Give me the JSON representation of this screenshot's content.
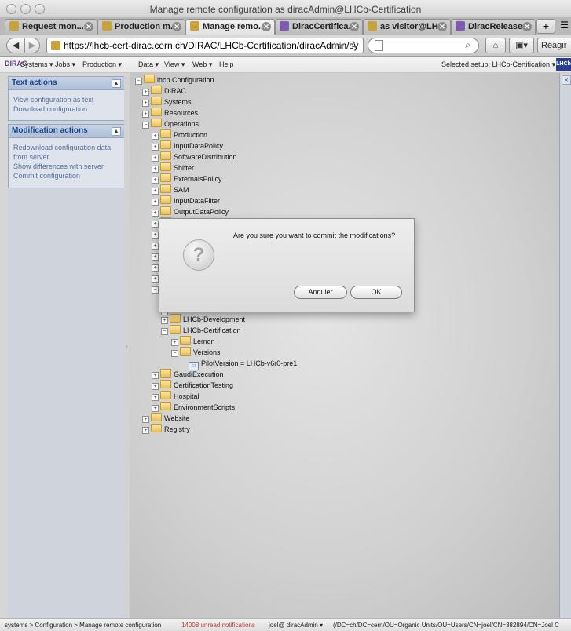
{
  "window": {
    "title": "Manage remote configuration as diracAdmin@LHCb-Certification"
  },
  "tabs": [
    {
      "label": "Request mon...",
      "icon": "lhcb-favicon",
      "active": false
    },
    {
      "label": "Production m...",
      "icon": "lhcb-favicon",
      "active": false
    },
    {
      "label": "Manage remo...",
      "icon": "lhcb-favicon",
      "active": true
    },
    {
      "label": "DiracCertifica...",
      "icon": "dirac-favicon",
      "active": false
    },
    {
      "label": "as visitor@LH...",
      "icon": "lhcb-favicon",
      "active": false
    },
    {
      "label": "DiracRelease...",
      "icon": "dirac-favicon",
      "active": false
    }
  ],
  "newtab": "+",
  "nav": {
    "url": "https://lhcb-cert-dirac.cern.ch/DIRAC/LHCb-Certification/diracAdmin/sy",
    "reagir": "Réagir"
  },
  "menu": {
    "logo": "DIRAC",
    "items": [
      "Systems ▾",
      "Jobs ▾",
      "Production ▾",
      "Data ▾",
      "View ▾",
      "Web ▾",
      "Help"
    ],
    "setup": "Selected setup:  LHCb-Certification ▾",
    "brand": "LHCb"
  },
  "text_actions": {
    "title": "Text actions",
    "links": [
      "View configuration as text",
      "Download configuration"
    ]
  },
  "modification_actions": {
    "title": "Modification actions",
    "links": [
      "Redownload configuration data",
      "from server",
      "Show differences with server",
      "Commit configuration"
    ]
  },
  "tree": [
    {
      "label": "lhcb Configuration",
      "expanded": true
    },
    {
      "label": "DIRAC",
      "expanded": false
    },
    {
      "label": "Systems",
      "expanded": false
    },
    {
      "label": "Resources",
      "expanded": false
    },
    {
      "label": "Operations",
      "expanded": true
    },
    {
      "label": "Production",
      "expanded": false
    },
    {
      "label": "InputDataPolicy",
      "expanded": false
    },
    {
      "label": "SoftwareDistribution",
      "expanded": false
    },
    {
      "label": "Shifter",
      "expanded": false
    },
    {
      "label": "ExternalsPolicy",
      "expanded": false
    },
    {
      "label": "SAM",
      "expanded": false
    },
    {
      "label": "InputDataFilter",
      "expanded": false
    },
    {
      "label": "OutputDataPolicy",
      "expanded": false
    },
    {
      "label": "LHCb-Development",
      "expanded": false
    },
    {
      "label": "LHCb-Certification",
      "expanded": true
    },
    {
      "label": "Lemon",
      "expanded": false
    },
    {
      "label": "Versions",
      "expanded": true
    },
    {
      "label": "PilotVersion = LHCb-v6r0-pre1",
      "leaf": true
    },
    {
      "label": "GaudiExecution",
      "expanded": false
    },
    {
      "label": "CertificationTesting",
      "expanded": false
    },
    {
      "label": "Hospital",
      "expanded": false
    },
    {
      "label": "EnvironmentScripts",
      "expanded": false
    },
    {
      "label": "Website",
      "expanded": false
    },
    {
      "label": "Registry",
      "expanded": false
    }
  ],
  "dialog": {
    "message": "Are you sure you want to commit the modifications?",
    "cancel": "Annuler",
    "ok": "OK",
    "icon": "question-icon"
  },
  "status": {
    "breadcrumb": "systems > Configuration > Manage remote configuration",
    "notifications": "14008 unread notifications",
    "user": "joel@  diracAdmin ▾",
    "dn": "(/DC=ch/DC=cern/OU=Organic Units/OU=Users/CN=joel/CN=382894/CN=Joel C"
  }
}
